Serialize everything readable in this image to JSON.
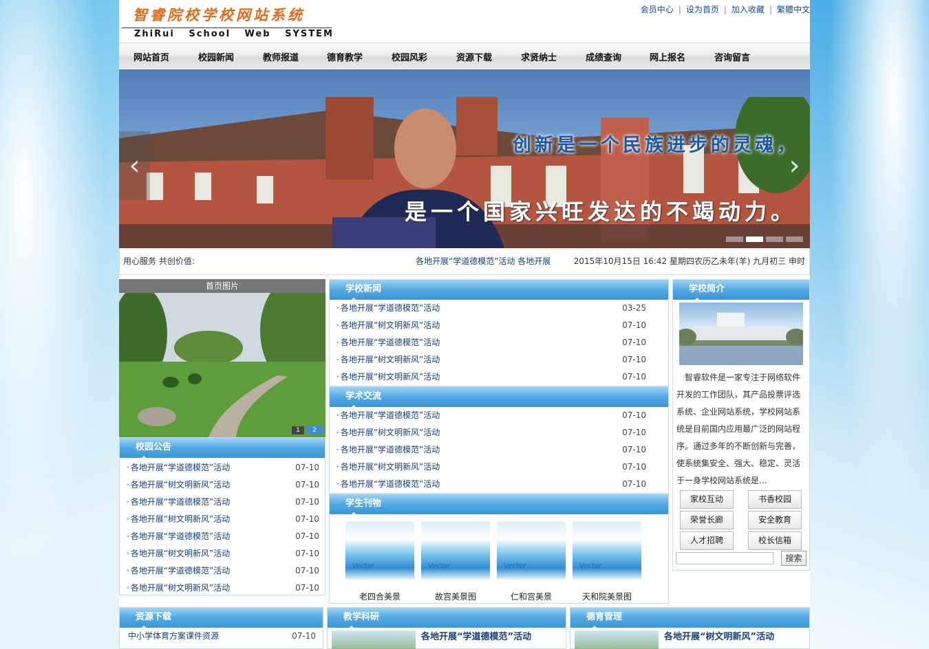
{
  "site": {
    "logo_cn": "智睿院校学校网站系统",
    "logo_en": "ZhiRui School Web SYSTEM"
  },
  "top_links": [
    "会员中心",
    "设为首页",
    "加入收藏",
    "繁體中文"
  ],
  "nav": [
    "网站首页",
    "校园新闻",
    "教师报道",
    "德育教学",
    "校园风彩",
    "资源下载",
    "求贤纳士",
    "成绩查询",
    "网上报名",
    "咨询留言"
  ],
  "banner": {
    "slogan1": "创新是一个民族进步的灵魂，",
    "slogan2": "是一个国家兴旺发达的不竭动力。",
    "prev": "‹",
    "next": "›"
  },
  "ticker": {
    "label": "用心服务 共创价值:",
    "scroll": "各地开展“学道德模范”活动  各地开展",
    "date": "2015年10月15日 16:42 星期四农历乙未年(羊) 九月初三 申时"
  },
  "photo": {
    "title": "首页图片",
    "pages": [
      "1",
      "2"
    ]
  },
  "notice": {
    "title": "校园公告",
    "items": [
      {
        "t": "各地开展“学道德模范”活动",
        "d": "07-10"
      },
      {
        "t": "各地开展“树文明新风”活动",
        "d": "07-10"
      },
      {
        "t": "各地开展“学道德模范”活动",
        "d": "07-10"
      },
      {
        "t": "各地开展“树文明新风”活动",
        "d": "07-10"
      },
      {
        "t": "各地开展“学道德模范”活动",
        "d": "07-10"
      },
      {
        "t": "各地开展“树文明新风”活动",
        "d": "07-10"
      },
      {
        "t": "各地开展“学道德模范”活动",
        "d": "07-10"
      },
      {
        "t": "各地开展“树文明新风”活动",
        "d": "07-10"
      }
    ]
  },
  "news": {
    "title": "学校新闻",
    "items": [
      {
        "t": "各地开展“学道德模范”活动",
        "d": "03-25"
      },
      {
        "t": "各地开展“树文明新风”活动",
        "d": "07-10"
      },
      {
        "t": "各地开展“学道德模范”活动",
        "d": "07-10"
      },
      {
        "t": "各地开展“树文明新风”活动",
        "d": "07-10"
      },
      {
        "t": "各地开展“树文明新风”活动",
        "d": "07-10"
      }
    ]
  },
  "academic": {
    "title": "学术交流",
    "items": [
      {
        "t": "各地开展“学道德模范”活动",
        "d": "07-10"
      },
      {
        "t": "各地开展“树文明新风”活动",
        "d": "07-10"
      },
      {
        "t": "各地开展“学道德模范”活动",
        "d": "07-10"
      },
      {
        "t": "各地开展“树文明新风”活动",
        "d": "07-10"
      },
      {
        "t": "各地开展“学道德模范”活动",
        "d": "07-10"
      }
    ]
  },
  "gallery": {
    "title": "学生刊物",
    "items": [
      "老四合美景",
      "故宫美景图",
      "仁和宫美景",
      "天和院美景图"
    ],
    "img_text": "Vector"
  },
  "intro": {
    "title": "学校简介",
    "text": "智睿软件是一家专注于网络软件开发的工作团队，其产品投票评选系统、企业网站系统，学校网站系统是目前国内应用最广泛的网站程序。通过多年的不断创新与完善，使系统集安全、强大、稳定、灵活于一身学校网站系统是...",
    "buttons": [
      "家校互动",
      "书香校园",
      "荣誉长廊",
      "安全教育",
      "人才招聘",
      "校长信箱"
    ],
    "search_btn": "搜索"
  },
  "resources": {
    "title": "资源下载",
    "items": [
      {
        "t": "中小学体育方案课件资源",
        "d": "07-10"
      }
    ]
  },
  "research": {
    "title": "教学科研",
    "headline": "各地开展“学道德模范”活动"
  },
  "moral": {
    "title": "德育管理",
    "headline": "各地开展“树文明新风”活动"
  }
}
